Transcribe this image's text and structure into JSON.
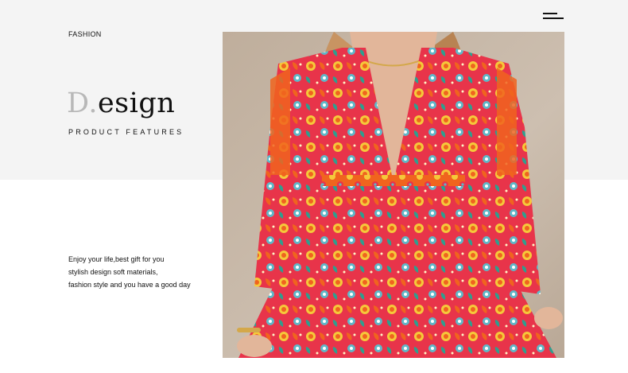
{
  "header": {
    "menu_icon": "hamburger-menu-icon",
    "category_label": "FASHION"
  },
  "hero": {
    "title_initial": "D.",
    "title_rest": "esign",
    "subtitle": "PRODUCT FEATURES"
  },
  "description": {
    "lines": [
      "Enjoy your life,best gift for you",
      "stylish design soft materials,",
      "fashion style and you have a good day"
    ]
  },
  "photo": {
    "subject": "model-in-paisley-print-dress",
    "colors": {
      "backdrop": "#c9b9a8",
      "dress_red": "#e8344a",
      "dress_orange": "#f0641e",
      "dress_yellow": "#f5c93a",
      "dress_teal": "#5fb8c8",
      "skin": "#e2b69a",
      "hair": "#c89462"
    }
  }
}
